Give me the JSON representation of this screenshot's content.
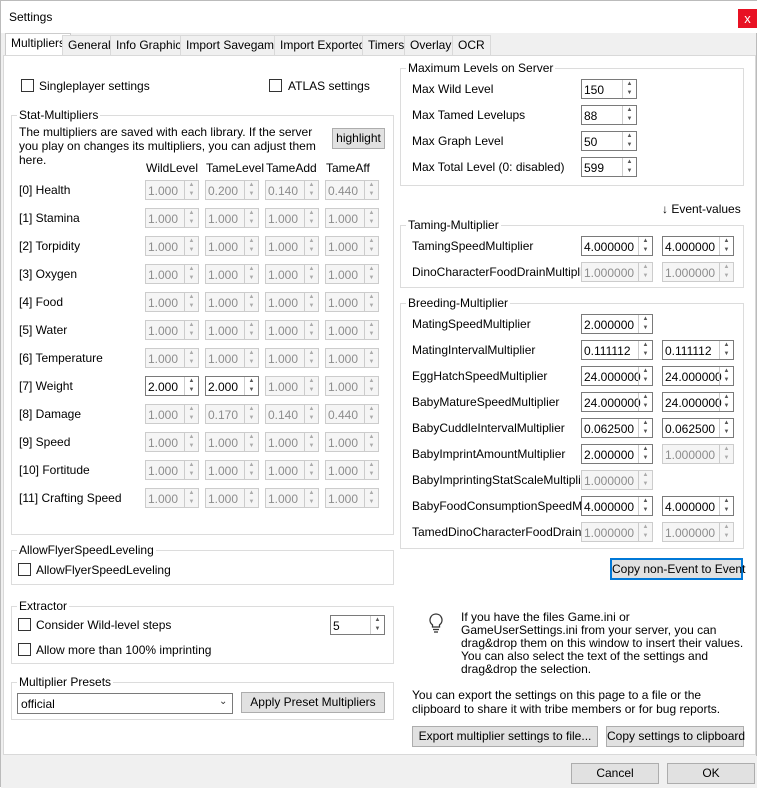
{
  "window": {
    "title": "Settings",
    "close_glyph": "x"
  },
  "tabs": [
    "Multipliers",
    "General",
    "Info Graphic",
    "Import Savegame",
    "Import Exported",
    "Timers",
    "Overlay",
    "OCR"
  ],
  "options": {
    "singleplayer": "Singleplayer settings",
    "atlas": "ATLAS settings"
  },
  "stat": {
    "title": "Stat-Multipliers",
    "note": "The multipliers are saved with each library. If the server you play on changes its multipliers, you can adjust them here.",
    "highlight": "highlight",
    "headers": [
      "WildLevel",
      "TameLevel",
      "TameAdd",
      "TameAff"
    ],
    "rows": [
      {
        "name": "[0] Health",
        "v": [
          "1.000",
          "0.200",
          "0.140",
          "0.440"
        ]
      },
      {
        "name": "[1] Stamina",
        "v": [
          "1.000",
          "1.000",
          "1.000",
          "1.000"
        ]
      },
      {
        "name": "[2] Torpidity",
        "v": [
          "1.000",
          "1.000",
          "1.000",
          "1.000"
        ]
      },
      {
        "name": "[3] Oxygen",
        "v": [
          "1.000",
          "1.000",
          "1.000",
          "1.000"
        ]
      },
      {
        "name": "[4] Food",
        "v": [
          "1.000",
          "1.000",
          "1.000",
          "1.000"
        ]
      },
      {
        "name": "[5] Water",
        "v": [
          "1.000",
          "1.000",
          "1.000",
          "1.000"
        ]
      },
      {
        "name": "[6] Temperature",
        "v": [
          "1.000",
          "1.000",
          "1.000",
          "1.000"
        ]
      },
      {
        "name": "[7] Weight",
        "v": [
          "2.000",
          "2.000",
          "1.000",
          "1.000"
        ]
      },
      {
        "name": "[8] Damage",
        "v": [
          "1.000",
          "0.170",
          "0.140",
          "0.440"
        ]
      },
      {
        "name": "[9] Speed",
        "v": [
          "1.000",
          "1.000",
          "1.000",
          "1.000"
        ]
      },
      {
        "name": "[10] Fortitude",
        "v": [
          "1.000",
          "1.000",
          "1.000",
          "1.000"
        ]
      },
      {
        "name": "[11] Crafting Speed",
        "v": [
          "1.000",
          "1.000",
          "1.000",
          "1.000"
        ]
      }
    ]
  },
  "flyer": {
    "title": "AllowFlyerSpeedLeveling",
    "label": "AllowFlyerSpeedLeveling"
  },
  "extractor": {
    "title": "Extractor",
    "wild_steps": "Consider Wild-level steps",
    "wild_steps_value": "5",
    "imprinting": "Allow more than 100% imprinting"
  },
  "presets": {
    "title": "Multiplier Presets",
    "selected": "official",
    "apply": "Apply Preset Multipliers"
  },
  "maxlevels": {
    "title": "Maximum Levels on Server",
    "rows": [
      {
        "label": "Max Wild Level",
        "value": "150"
      },
      {
        "label": "Max Tamed Levelups",
        "value": "88"
      },
      {
        "label": "Max Graph Level",
        "value": "50"
      },
      {
        "label": "Max Total Level (0: disabled)",
        "value": "599"
      }
    ]
  },
  "event_values": "↓ Event-values",
  "taming": {
    "title": "Taming-Multiplier",
    "rows": [
      {
        "label": "TamingSpeedMultiplier",
        "value": "4.000000",
        "event": "4.000000"
      },
      {
        "label": "DinoCharacterFoodDrainMultiplier",
        "value": "1.000000",
        "event": "1.000000"
      }
    ]
  },
  "breeding": {
    "title": "Breeding-Multiplier",
    "rows": [
      {
        "label": "MatingSpeedMultiplier",
        "value": "2.000000",
        "event": ""
      },
      {
        "label": "MatingIntervalMultiplier",
        "value": "0.111112",
        "event": "0.111112"
      },
      {
        "label": "EggHatchSpeedMultiplier",
        "value": "24.000000",
        "event": "24.000000"
      },
      {
        "label": "BabyMatureSpeedMultiplier",
        "value": "24.000000",
        "event": "24.000000"
      },
      {
        "label": "BabyCuddleIntervalMultiplier",
        "value": "0.062500",
        "event": "0.062500"
      },
      {
        "label": "BabyImprintAmountMultiplier",
        "value": "2.000000",
        "event": "1.000000"
      },
      {
        "label": "BabyImprintingStatScaleMultiplier",
        "value": "1.000000",
        "event": ""
      },
      {
        "label": "BabyFoodConsumptionSpeedMult",
        "value": "4.000000",
        "event": "4.000000"
      },
      {
        "label": "TamedDinoCharacterFoodDrainMult",
        "value": "1.000000",
        "event": "1.000000"
      }
    ]
  },
  "copy_event": "Copy non-Event to Event",
  "info": {
    "text1": "If you have the files Game.ini or GameUserSettings.ini from your server, you can drag&drop them on this window to insert their values.",
    "text2": "You can also select the text of the settings and drag&drop the selection.",
    "export_text": "You can export the settings on this page to a file or the clipboard to share it with tribe members or for bug reports.",
    "export_file": "Export multiplier settings to file...",
    "copy_clip": "Copy settings to clipboard"
  },
  "footer": {
    "cancel": "Cancel",
    "ok": "OK"
  }
}
